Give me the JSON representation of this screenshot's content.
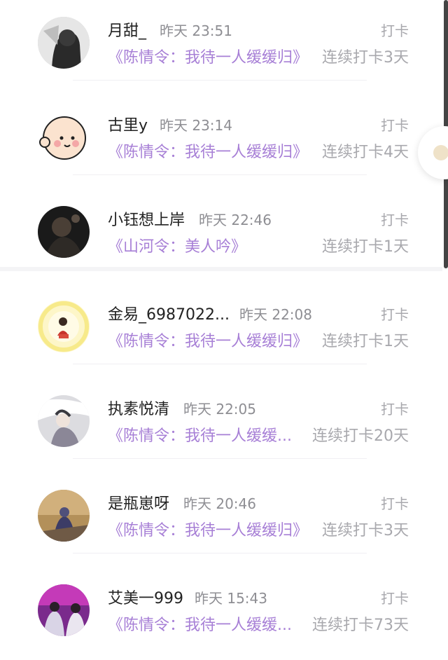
{
  "entries": [
    {
      "name": "月甜_",
      "time": "昨天 23:51",
      "action": "打卡",
      "book": "《陈情令：我待一人缓缓归》",
      "streak": "连续打卡3天",
      "avatar": "dark-portrait"
    },
    {
      "name": "古里y",
      "time": "昨天 23:14",
      "action": "打卡",
      "book": "《陈情令：我待一人缓缓归》",
      "streak": "连续打卡4天",
      "avatar": "cartoon-baby-face"
    },
    {
      "name": "小钰想上岸",
      "time": "昨天 22:46",
      "action": "打卡",
      "book": "《山河令：美人吟》",
      "streak": "连续打卡1天",
      "avatar": "dark-photo"
    },
    {
      "name": "金易_6987022...",
      "time": "昨天 22:08",
      "action": "打卡",
      "book": "《陈情令：我待一人缓缓归》",
      "streak": "连续打卡1天",
      "avatar": "yellow-ring-figure"
    },
    {
      "name": "执素悦清",
      "time": "昨天 22:05",
      "action": "打卡",
      "book": "《陈情令：我待一人缓缓...",
      "streak": "连续打卡20天",
      "avatar": "ink-illustration"
    },
    {
      "name": "是瓶崽呀",
      "time": "昨天 20:46",
      "action": "打卡",
      "book": "《陈情令：我待一人缓缓归》",
      "streak": "连续打卡3天",
      "avatar": "dusk-figure"
    },
    {
      "name": "艾美一999",
      "time": "昨天 15:43",
      "action": "打卡",
      "book": "《陈情令：我待一人缓缓...",
      "streak": "连续打卡73天",
      "avatar": "stage-photo"
    }
  ],
  "colors": {
    "book_title": "#a77fd6",
    "name": "#222222",
    "meta": "#8e8e93",
    "muted": "#a8a8ad"
  }
}
